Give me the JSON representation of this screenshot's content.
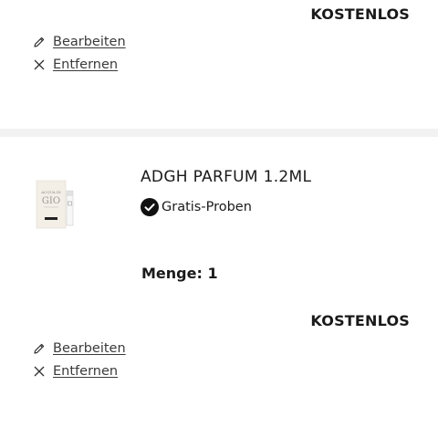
{
  "item1": {
    "price": "KOSTENLOS",
    "edit_label": "Bearbeiten",
    "remove_label": "Entfernen"
  },
  "item2": {
    "image_alt": "ADGH Parfum Probe",
    "name": "ADGH PARFUM 1.2ML",
    "badge": "Gratis-Proben",
    "quantity": "Menge: 1",
    "price": "KOSTENLOS",
    "edit_label": "Bearbeiten",
    "remove_label": "Entfernen"
  }
}
